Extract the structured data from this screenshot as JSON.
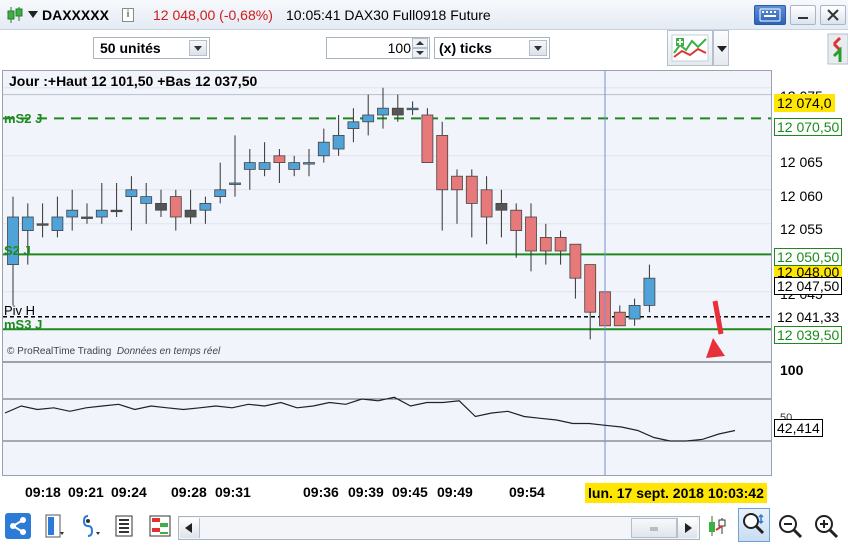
{
  "titlebar": {
    "symbol": "DAXXXXX",
    "price_change": "12 048,00 (-0,68%)",
    "time_and_contract": "10:05:41 DAX30 Full0918 Future",
    "info_icon_text": "i"
  },
  "toolbar": {
    "units": "50 unités",
    "ticks_value": "100",
    "ticks_label": "(x) ticks"
  },
  "chart": {
    "day_title": "Jour :+Haut 12 101,50 +Bas 12 037,50",
    "level_mS2": "mS2 J",
    "level_S2": "S2 J",
    "level_pivH": "Piv H",
    "level_mS3": "mS3 J",
    "copyright": "© ProRealTime Trading",
    "realtime": "Données en temps réel"
  },
  "price_axis": {
    "ticks": [
      "12 075",
      "12 065",
      "12 060",
      "12 055",
      "12 045"
    ],
    "box_high": "12 074,0",
    "box_mS2": "12 070,50",
    "box_S2": "12 050,50",
    "box_last": "12 048,00",
    "box_current": "12 047,50",
    "box_pivH": "12 041,33",
    "box_mS3": "12 039,50"
  },
  "osc_axis": {
    "tick_top": "100",
    "tick_mid": "50",
    "value": "42,414"
  },
  "time_axis": {
    "ticks": [
      "09:18",
      "09:21",
      "09:24",
      "09:28",
      "09:31",
      "09:36",
      "09:39",
      "09:45",
      "09:49",
      "09:54"
    ],
    "cursor_date": "lun. 17 sept. 2018 10:03:42"
  },
  "colors": {
    "up_candle": "#4fa3d8",
    "down_candle": "#e8797a",
    "level_green": "#1e8a1e",
    "cursor_yellow": "#ffe600",
    "arrow_red": "#e8303a"
  },
  "chart_data": {
    "type": "candlestick",
    "y_range": [
      12036,
      12076
    ],
    "candles": [
      {
        "o": 12049,
        "h": 12059,
        "l": 12043,
        "c": 12056,
        "dir": "up"
      },
      {
        "o": 12054,
        "h": 12058,
        "l": 12049,
        "c": 12056,
        "dir": "up"
      },
      {
        "o": 12055,
        "h": 12058,
        "l": 12053,
        "c": 12055,
        "dir": "flat"
      },
      {
        "o": 12054,
        "h": 12059,
        "l": 12053,
        "c": 12056,
        "dir": "up"
      },
      {
        "o": 12056,
        "h": 12060,
        "l": 12054,
        "c": 12057,
        "dir": "up"
      },
      {
        "o": 12056,
        "h": 12058,
        "l": 12055,
        "c": 12056,
        "dir": "flat"
      },
      {
        "o": 12056,
        "h": 12061,
        "l": 12055,
        "c": 12057,
        "dir": "up"
      },
      {
        "o": 12057,
        "h": 12061,
        "l": 12056,
        "c": 12057,
        "dir": "flat"
      },
      {
        "o": 12060,
        "h": 12062,
        "l": 12054,
        "c": 12059,
        "dir": "up"
      },
      {
        "o": 12059,
        "h": 12061,
        "l": 12055,
        "c": 12058,
        "dir": "up"
      },
      {
        "o": 12058,
        "h": 12060,
        "l": 12056,
        "c": 12057,
        "dir": "flat"
      },
      {
        "o": 12059,
        "h": 12060,
        "l": 12054,
        "c": 12056,
        "dir": "down"
      },
      {
        "o": 12057,
        "h": 12060,
        "l": 12055,
        "c": 12056,
        "dir": "flat"
      },
      {
        "o": 12058,
        "h": 12059,
        "l": 12055,
        "c": 12057,
        "dir": "up"
      },
      {
        "o": 12060,
        "h": 12064,
        "l": 12058,
        "c": 12059,
        "dir": "up"
      },
      {
        "o": 12061,
        "h": 12068,
        "l": 12059,
        "c": 12061,
        "dir": "up"
      },
      {
        "o": 12064,
        "h": 12066,
        "l": 12060,
        "c": 12063,
        "dir": "up"
      },
      {
        "o": 12064,
        "h": 12067,
        "l": 12062,
        "c": 12063,
        "dir": "up"
      },
      {
        "o": 12065,
        "h": 12066,
        "l": 12061,
        "c": 12064,
        "dir": "down"
      },
      {
        "o": 12064,
        "h": 12065,
        "l": 12062,
        "c": 12063,
        "dir": "up"
      },
      {
        "o": 12064,
        "h": 12066,
        "l": 12062,
        "c": 12064,
        "dir": "up"
      },
      {
        "o": 12067,
        "h": 12069,
        "l": 12064,
        "c": 12065,
        "dir": "up"
      },
      {
        "o": 12068,
        "h": 12071,
        "l": 12065,
        "c": 12066,
        "dir": "up"
      },
      {
        "o": 12070,
        "h": 12072,
        "l": 12067,
        "c": 12069,
        "dir": "up"
      },
      {
        "o": 12071,
        "h": 12074,
        "l": 12068,
        "c": 12070,
        "dir": "up"
      },
      {
        "o": 12072,
        "h": 12075,
        "l": 12069,
        "c": 12071,
        "dir": "up"
      },
      {
        "o": 12072,
        "h": 12074,
        "l": 12070,
        "c": 12071,
        "dir": "flat"
      },
      {
        "o": 12072,
        "h": 12073,
        "l": 12071,
        "c": 12072,
        "dir": "up"
      },
      {
        "o": 12071,
        "h": 12072,
        "l": 12064,
        "c": 12064,
        "dir": "down"
      },
      {
        "o": 12068,
        "h": 12070,
        "l": 12054,
        "c": 12060,
        "dir": "down"
      },
      {
        "o": 12062,
        "h": 12063,
        "l": 12055,
        "c": 12060,
        "dir": "down"
      },
      {
        "o": 12062,
        "h": 12063,
        "l": 12053,
        "c": 12058,
        "dir": "down"
      },
      {
        "o": 12060,
        "h": 12062,
        "l": 12052,
        "c": 12056,
        "dir": "down"
      },
      {
        "o": 12058,
        "h": 12060,
        "l": 12053,
        "c": 12057,
        "dir": "flat"
      },
      {
        "o": 12057,
        "h": 12058,
        "l": 12050,
        "c": 12054,
        "dir": "down"
      },
      {
        "o": 12056,
        "h": 12058,
        "l": 12048,
        "c": 12051,
        "dir": "down"
      },
      {
        "o": 12053,
        "h": 12055,
        "l": 12049,
        "c": 12051,
        "dir": "down"
      },
      {
        "o": 12053,
        "h": 12054,
        "l": 12049,
        "c": 12051,
        "dir": "down"
      },
      {
        "o": 12052,
        "h": 12052,
        "l": 12044,
        "c": 12047,
        "dir": "down"
      },
      {
        "o": 12049,
        "h": 12049,
        "l": 12038,
        "c": 12042,
        "dir": "down"
      },
      {
        "o": 12045,
        "h": 12046,
        "l": 12038,
        "c": 12040,
        "dir": "down"
      },
      {
        "o": 12042,
        "h": 12043,
        "l": 12040,
        "c": 12040,
        "dir": "down"
      },
      {
        "o": 12041,
        "h": 12044,
        "l": 12040,
        "c": 12043,
        "dir": "up"
      },
      {
        "o": 12043,
        "h": 12049,
        "l": 12042,
        "c": 12047,
        "dir": "up"
      }
    ],
    "levels": {
      "mS2": 12070.5,
      "S2": 12050.5,
      "pivH": 12041.33,
      "mS3": 12039.5
    },
    "oscillator": {
      "y_range": [
        0,
        100
      ],
      "values": [
        44,
        48,
        46,
        47,
        45,
        47,
        48,
        49,
        46,
        48,
        47,
        46,
        47,
        48,
        47,
        49,
        48,
        50,
        47,
        48,
        50,
        49,
        52,
        51,
        53,
        48,
        50,
        50,
        51,
        42,
        44,
        45,
        42,
        41,
        40,
        38,
        38,
        37,
        36,
        34,
        30,
        28,
        28,
        29,
        32,
        34
      ]
    }
  }
}
